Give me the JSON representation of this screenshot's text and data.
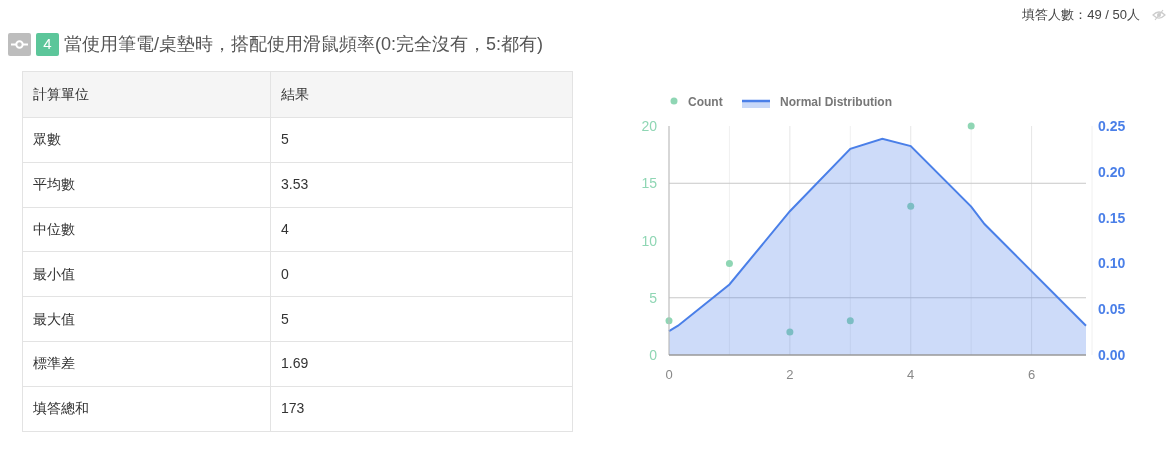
{
  "respondents": "填答人數：49 / 50人",
  "question": {
    "number": "4",
    "title": "當使用筆電/桌墊時，搭配使用滑鼠頻率(0:完全沒有，5:都有)"
  },
  "table": {
    "columns": [
      "計算單位",
      "結果"
    ],
    "rows": [
      [
        "眾數",
        "5"
      ],
      [
        "平均數",
        "3.53"
      ],
      [
        "中位數",
        "4"
      ],
      [
        "最小值",
        "0"
      ],
      [
        "最大值",
        "5"
      ],
      [
        "標準差",
        "1.69"
      ],
      [
        "填答總和",
        "173"
      ]
    ]
  },
  "chart_data": {
    "type": "scatter",
    "grid": true,
    "legend": true,
    "xlim": [
      0,
      6.9
    ],
    "ylim": [
      0,
      20
    ],
    "y2lim": [
      0,
      0.25
    ],
    "xticks": [
      {
        "value": 0,
        "label": "0"
      },
      {
        "value": 2,
        "label": "2"
      },
      {
        "value": 4,
        "label": "4"
      },
      {
        "value": 6,
        "label": "6"
      }
    ],
    "yticks": [
      {
        "value": 0,
        "label": "0"
      },
      {
        "value": 5,
        "label": "5"
      },
      {
        "value": 10,
        "label": "10"
      },
      {
        "value": 15,
        "label": "15"
      },
      {
        "value": 20,
        "label": "20"
      }
    ],
    "y2ticks": [
      {
        "value": 0,
        "label": "0.00"
      },
      {
        "value": 0.05,
        "label": "0.05"
      },
      {
        "value": 0.1,
        "label": "0.10"
      },
      {
        "value": 0.15,
        "label": "0.15"
      },
      {
        "value": 0.2,
        "label": "0.20"
      },
      {
        "value": 0.25,
        "label": "0.25"
      }
    ],
    "series": [
      {
        "name": "Count",
        "color": "#8fd6b4",
        "x": [
          0,
          1,
          2,
          3,
          4,
          5
        ],
        "values": [
          3,
          8,
          2,
          3,
          13,
          20
        ]
      },
      {
        "name": "Normal Distribution",
        "type": "area",
        "axis": "y2",
        "color": "#4a7fe8",
        "x": [
          0,
          0.15,
          1,
          2,
          3,
          3.53,
          4,
          5,
          5.22,
          6.9
        ],
        "values": [
          0.026,
          0.032,
          0.077,
          0.157,
          0.225,
          0.236,
          0.228,
          0.162,
          0.143,
          0.032
        ]
      }
    ]
  }
}
